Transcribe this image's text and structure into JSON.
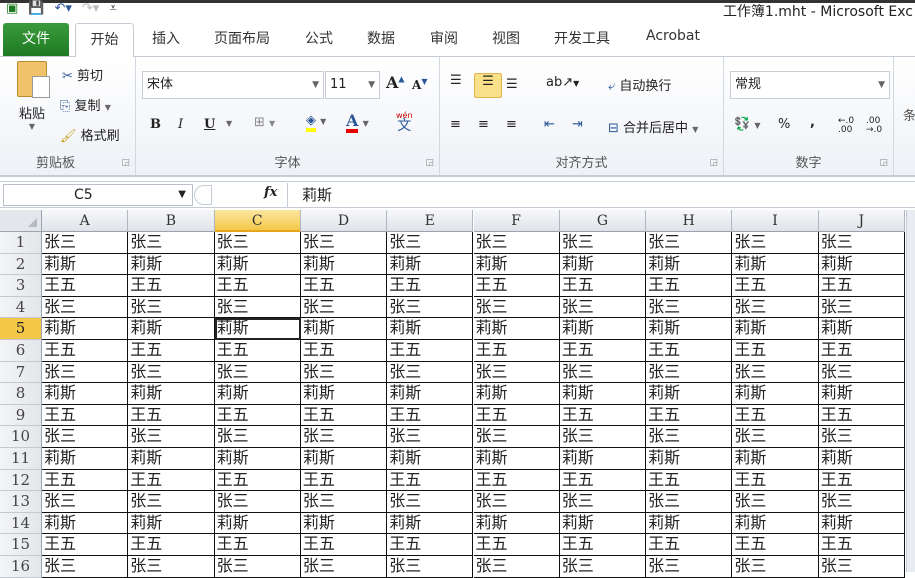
{
  "window": {
    "title": "工作簿1.mht - Microsoft Exc"
  },
  "tabs": [
    "文件",
    "开始",
    "插入",
    "页面布局",
    "公式",
    "数据",
    "审阅",
    "视图",
    "开发工具",
    "Acrobat"
  ],
  "clipboard": {
    "paste": "粘贴",
    "cut": "剪切",
    "copy": "复制",
    "format_painter": "格式刷",
    "label": "剪贴板"
  },
  "font": {
    "name": "宋体",
    "size": "11",
    "bold": "B",
    "italic": "I",
    "underline": "U",
    "phonetic": "wén",
    "label": "字体",
    "grow": "A",
    "shrink": "A",
    "font_color": "A"
  },
  "alignment": {
    "wrap": "自动换行",
    "merge": "合并后居中",
    "label": "对齐方式"
  },
  "number": {
    "format": "常规",
    "percent": "%",
    "comma": ",",
    "inc": "←.0 .00",
    "dec": ".00 →.0",
    "label": "数字"
  },
  "styles": {
    "partial": "条"
  },
  "formula_bar": {
    "name_box": "C5",
    "fx": "fx",
    "value": "莉斯"
  },
  "columns": [
    "A",
    "B",
    "C",
    "D",
    "E",
    "F",
    "G",
    "H",
    "I",
    "J"
  ],
  "active": {
    "row": 5,
    "col": "C"
  },
  "rows": [
    [
      "张三",
      "张三",
      "张三",
      "张三",
      "张三",
      "张三",
      "张三",
      "张三",
      "张三",
      "张三"
    ],
    [
      "莉斯",
      "莉斯",
      "莉斯",
      "莉斯",
      "莉斯",
      "莉斯",
      "莉斯",
      "莉斯",
      "莉斯",
      "莉斯"
    ],
    [
      "王五",
      "王五",
      "王五",
      "王五",
      "王五",
      "王五",
      "王五",
      "王五",
      "王五",
      "王五"
    ],
    [
      "张三",
      "张三",
      "张三",
      "张三",
      "张三",
      "张三",
      "张三",
      "张三",
      "张三",
      "张三"
    ],
    [
      "莉斯",
      "莉斯",
      "莉斯",
      "莉斯",
      "莉斯",
      "莉斯",
      "莉斯",
      "莉斯",
      "莉斯",
      "莉斯"
    ],
    [
      "王五",
      "王五",
      "王五",
      "王五",
      "王五",
      "王五",
      "王五",
      "王五",
      "王五",
      "王五"
    ],
    [
      "张三",
      "张三",
      "张三",
      "张三",
      "张三",
      "张三",
      "张三",
      "张三",
      "张三",
      "张三"
    ],
    [
      "莉斯",
      "莉斯",
      "莉斯",
      "莉斯",
      "莉斯",
      "莉斯",
      "莉斯",
      "莉斯",
      "莉斯",
      "莉斯"
    ],
    [
      "王五",
      "王五",
      "王五",
      "王五",
      "王五",
      "王五",
      "王五",
      "王五",
      "王五",
      "王五"
    ],
    [
      "张三",
      "张三",
      "张三",
      "张三",
      "张三",
      "张三",
      "张三",
      "张三",
      "张三",
      "张三"
    ],
    [
      "莉斯",
      "莉斯",
      "莉斯",
      "莉斯",
      "莉斯",
      "莉斯",
      "莉斯",
      "莉斯",
      "莉斯",
      "莉斯"
    ],
    [
      "王五",
      "王五",
      "王五",
      "王五",
      "王五",
      "王五",
      "王五",
      "王五",
      "王五",
      "王五"
    ],
    [
      "张三",
      "张三",
      "张三",
      "张三",
      "张三",
      "张三",
      "张三",
      "张三",
      "张三",
      "张三"
    ],
    [
      "莉斯",
      "莉斯",
      "莉斯",
      "莉斯",
      "莉斯",
      "莉斯",
      "莉斯",
      "莉斯",
      "莉斯",
      "莉斯"
    ],
    [
      "王五",
      "王五",
      "王五",
      "王五",
      "王五",
      "王五",
      "王五",
      "王五",
      "王五",
      "王五"
    ],
    [
      "张三",
      "张三",
      "张三",
      "张三",
      "张三",
      "张三",
      "张三",
      "张三",
      "张三",
      "张三"
    ]
  ]
}
